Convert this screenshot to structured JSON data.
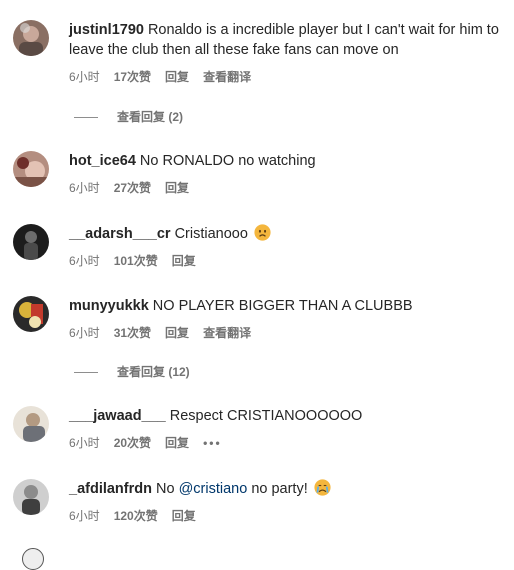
{
  "comments": [
    {
      "username": "justinl1790",
      "text": "Ronaldo is a incredible player but I can't wait for him to leave the club then all these fake fans can move on",
      "time": "6小时",
      "likes": "17次赞",
      "reply": "回复",
      "translate": "查看翻译",
      "view_replies": "查看回复 (2)"
    },
    {
      "username": "hot_ice64",
      "text": "No RONALDO no watching",
      "time": "6小时",
      "likes": "27次赞",
      "reply": "回复"
    },
    {
      "username": "__adarsh___cr",
      "text": "Cristianooo",
      "emoji": "sad-face-emoji",
      "time": "6小时",
      "likes": "101次赞",
      "reply": "回复"
    },
    {
      "username": "munyyukkk",
      "text": "NO PLAYER BIGGER THAN A CLUBBB",
      "time": "6小时",
      "likes": "31次赞",
      "reply": "回复",
      "translate": "查看翻译",
      "view_replies": "查看回复 (12)"
    },
    {
      "username": "___jawaad___",
      "text": "Respect CRISTIANOOOOOO",
      "time": "6小时",
      "likes": "20次赞",
      "reply": "回复",
      "more": "•••"
    },
    {
      "username": "_afdilanfrdn",
      "text_before": "No",
      "mention": "@cristiano",
      "text_after": "no party!",
      "emoji": "crying-face-emoji",
      "time": "6小时",
      "likes": "120次赞",
      "reply": "回复"
    }
  ],
  "colors": {
    "text": "#262626",
    "secondary": "#737373",
    "mention": "#00376b"
  }
}
